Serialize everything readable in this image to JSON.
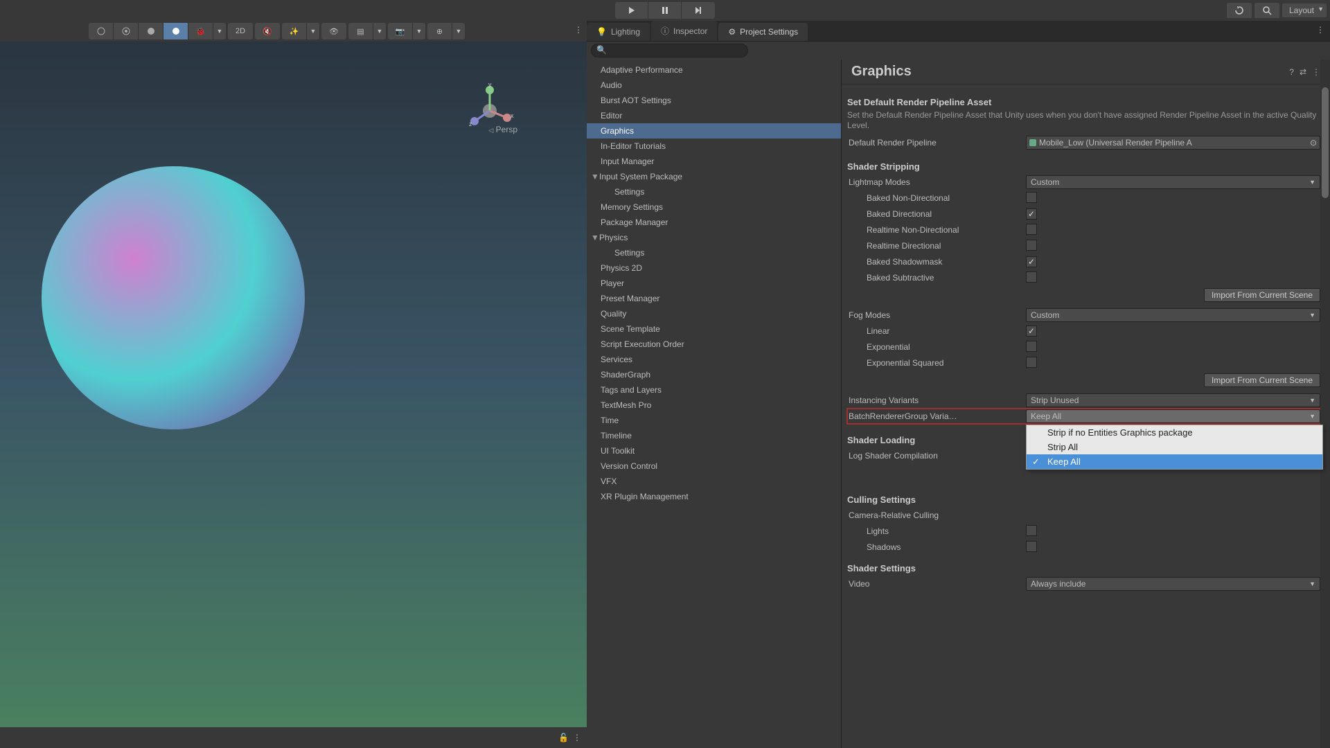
{
  "topbar": {
    "layout_label": "Layout"
  },
  "tabs": {
    "lighting": "Lighting",
    "inspector": "Inspector",
    "project_settings": "Project Settings"
  },
  "scene": {
    "persp": "Persp",
    "mode_2d": "2D"
  },
  "categories": [
    "Adaptive Performance",
    "Audio",
    "Burst AOT Settings",
    "Editor",
    "Graphics",
    "In-Editor Tutorials",
    "Input Manager",
    "Input System Package",
    "Settings",
    "Memory Settings",
    "Package Manager",
    "Physics",
    "Settings",
    "Physics 2D",
    "Player",
    "Preset Manager",
    "Quality",
    "Scene Template",
    "Script Execution Order",
    "Services",
    "ShaderGraph",
    "Tags and Layers",
    "TextMesh Pro",
    "Time",
    "Timeline",
    "UI Toolkit",
    "Version Control",
    "VFX",
    "XR Plugin Management"
  ],
  "graphics": {
    "title": "Graphics",
    "default_pipeline": {
      "heading": "Set Default Render Pipeline Asset",
      "desc": "Set the Default Render Pipeline Asset that Unity uses when you don't have assigned Render Pipeline Asset in the active Quality Level.",
      "label": "Default Render Pipeline",
      "value": "Mobile_Low (Universal Render Pipeline A"
    },
    "shader_stripping": {
      "heading": "Shader Stripping",
      "lightmap_modes_label": "Lightmap Modes",
      "lightmap_modes_value": "Custom",
      "baked_non_directional": "Baked Non-Directional",
      "baked_directional": "Baked Directional",
      "realtime_non_directional": "Realtime Non-Directional",
      "realtime_directional": "Realtime Directional",
      "baked_shadowmask": "Baked Shadowmask",
      "baked_subtractive": "Baked Subtractive",
      "import_btn": "Import From Current Scene"
    },
    "fog": {
      "label": "Fog Modes",
      "value": "Custom",
      "linear": "Linear",
      "exponential": "Exponential",
      "exponential_squared": "Exponential Squared",
      "import_btn": "Import From Current Scene"
    },
    "instancing": {
      "label": "Instancing Variants",
      "value": "Strip Unused"
    },
    "brg": {
      "label": "BatchRendererGroup Varia…",
      "value": "Keep All",
      "options": [
        "Strip if no Entities Graphics package",
        "Strip All",
        "Keep All"
      ]
    },
    "shader_loading": {
      "heading": "Shader Loading",
      "log_label": "Log Shader Compilation"
    },
    "culling": {
      "heading": "Culling Settings",
      "camera_relative": "Camera-Relative Culling",
      "lights": "Lights",
      "shadows": "Shadows"
    },
    "shader_settings": {
      "heading": "Shader Settings",
      "video_label": "Video",
      "video_value": "Always include"
    }
  }
}
